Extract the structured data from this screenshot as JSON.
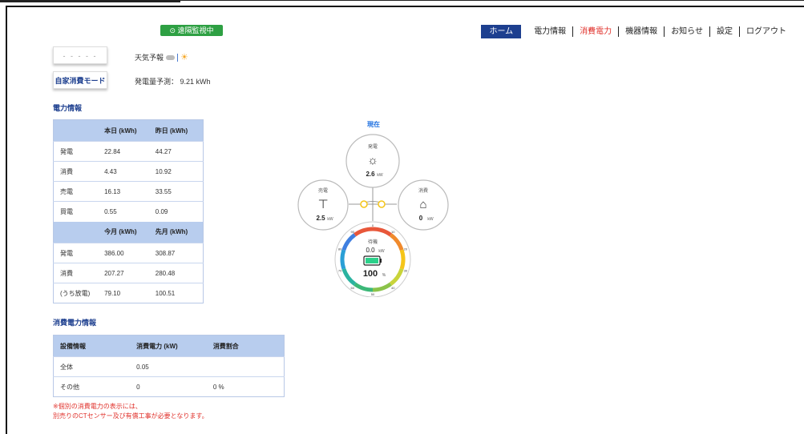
{
  "header": {
    "remote_badge": "⊙ 遠隔監視中",
    "nav": [
      {
        "label": "ホーム",
        "kind": "home"
      },
      {
        "label": "電力情報",
        "kind": "normal"
      },
      {
        "label": "消費電力",
        "kind": "active"
      },
      {
        "label": "機器情報",
        "kind": "normal"
      },
      {
        "label": "お知らせ",
        "kind": "normal"
      },
      {
        "label": "設定",
        "kind": "normal"
      },
      {
        "label": "ログアウト",
        "kind": "normal"
      }
    ]
  },
  "top_left": {
    "button1_label": "- - - - -",
    "mode_button_label": "自家消費モード",
    "weather_label": "天気予報",
    "forecast_label": "発電量予測： 9.21 kWh"
  },
  "power_info": {
    "title": "電力情報",
    "daily_headers": [
      "",
      "本日 (kWh)",
      "昨日 (kWh)"
    ],
    "daily_rows": [
      [
        "発電",
        "22.84",
        "44.27"
      ],
      [
        "消費",
        "4.43",
        "10.92"
      ],
      [
        "売電",
        "16.13",
        "33.55"
      ],
      [
        "買電",
        "0.55",
        "0.09"
      ]
    ],
    "monthly_headers": [
      "",
      "今月 (kWh)",
      "先月 (kWh)"
    ],
    "monthly_rows": [
      [
        "発電",
        "386.00",
        "308.87"
      ],
      [
        "消費",
        "207.27",
        "280.48"
      ],
      [
        "(うち放電)",
        "79.10",
        "100.51"
      ]
    ]
  },
  "consumption_info": {
    "title": "消費電力情報",
    "headers": [
      "設備情報",
      "消費電力 (kW)",
      "消費割合"
    ],
    "rows": [
      [
        "全体",
        "0.05",
        ""
      ],
      [
        "その他",
        "0",
        "0 %"
      ]
    ],
    "note_line1": "※個別の消費電力の表示には、",
    "note_line2": "別売りのCTセンサー及び有償工事が必要となります。"
  },
  "diagram": {
    "current_label": "現在",
    "generation": {
      "label": "発電",
      "value": "2.6",
      "unit": "kW"
    },
    "sell": {
      "label": "売電",
      "value": "2.5",
      "unit": "kW"
    },
    "consume": {
      "label": "消費",
      "value": "0",
      "unit": "kW"
    },
    "battery": {
      "label": "待機",
      "power": "0.0",
      "power_unit": "kW",
      "soc": "100",
      "soc_unit": "%",
      "soc_fraction": 1.0
    },
    "gauge_ticks": [
      "0",
      "10",
      "20",
      "30",
      "40",
      "50",
      "60",
      "70",
      "80",
      "90"
    ]
  },
  "colors": {
    "nav_home_bg": "#1d3f8f",
    "active_nav": "#e0312b",
    "badge_green": "#2ea043",
    "table_header": "#b8cdee",
    "note_red": "#e0312b",
    "accent_blue": "#1d6fe0",
    "flow_yellow": "#f5c518"
  }
}
